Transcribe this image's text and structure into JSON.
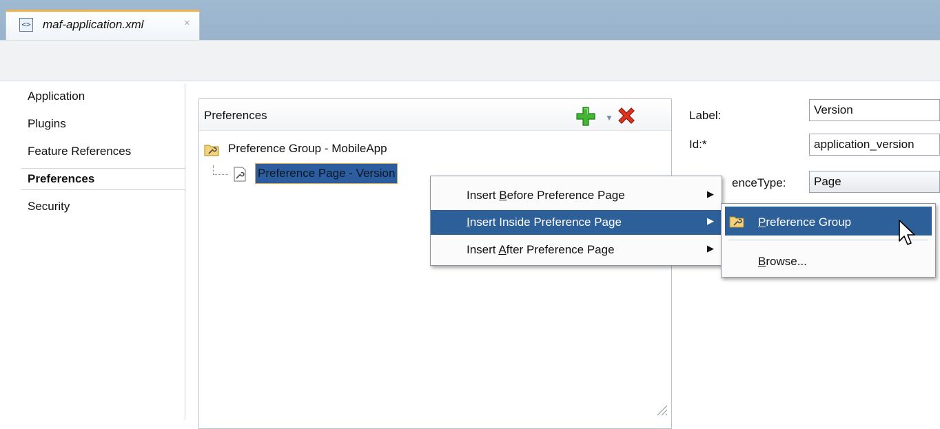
{
  "editor_tab": {
    "title": "maf-application.xml",
    "close": "×"
  },
  "nav": {
    "items": [
      {
        "label": "Application",
        "selected": false
      },
      {
        "label": "Plugins",
        "selected": false
      },
      {
        "label": "Feature References",
        "selected": false
      },
      {
        "label": "Preferences",
        "selected": true
      },
      {
        "label": "Security",
        "selected": false
      }
    ]
  },
  "preferences_panel": {
    "title": "Preferences",
    "tree": [
      {
        "label": "Preference Group - MobileApp",
        "icon": "preference-group-icon"
      },
      {
        "label": "Preference Page - Version",
        "icon": "preference-page-icon",
        "selected": true
      }
    ]
  },
  "properties": {
    "label_caption": "Label:",
    "label_value": "Version",
    "id_caption": "Id:*",
    "id_value": "application_version",
    "type_caption": "enceType:",
    "type_value": "Page"
  },
  "context_menu": {
    "items": [
      {
        "pre": "Insert ",
        "mn": "B",
        "post": "efore Preference Page",
        "highlighted": false
      },
      {
        "pre": "",
        "mn": "I",
        "post": "nsert Inside Preference Page",
        "highlighted": true
      },
      {
        "pre": "Insert ",
        "mn": "A",
        "post": "fter Preference Page",
        "highlighted": false
      }
    ],
    "submenu_arrow": "▶"
  },
  "submenu": {
    "items": [
      {
        "pre": "",
        "mn": "P",
        "post": "reference Group",
        "highlighted": true
      },
      {
        "pre": "",
        "mn": "B",
        "post": "rowse...",
        "highlighted": false
      }
    ]
  },
  "colors": {
    "highlight": "#2d5f98",
    "tab_accent": "#f2b04b",
    "add": "#3aa52f",
    "delete": "#d8321e"
  }
}
